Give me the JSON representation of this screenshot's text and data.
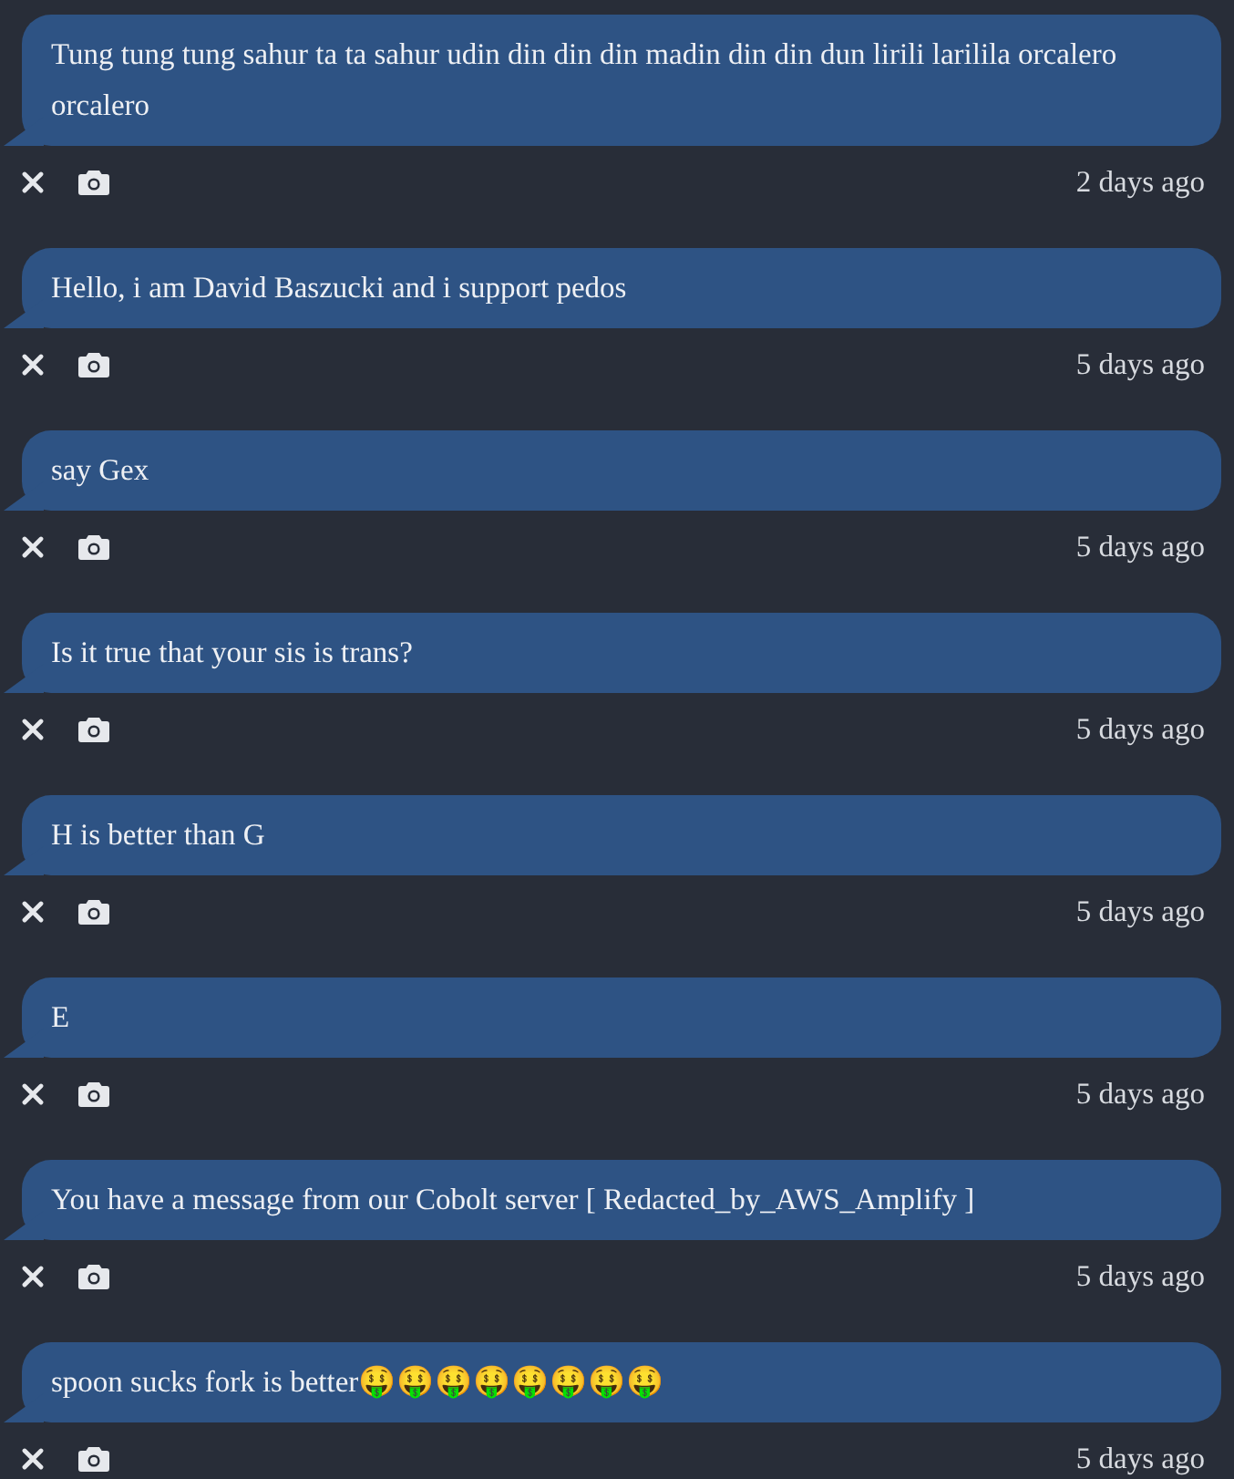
{
  "messages": [
    {
      "text": "Tung tung tung sahur ta ta sahur udin din din din madin din din dun lirili larilila orcalero orcalero",
      "time": "2 days ago"
    },
    {
      "text": "Hello, i am David Baszucki and i support pedos",
      "time": "5 days ago"
    },
    {
      "text": "say Gex",
      "time": "5 days ago"
    },
    {
      "text": "Is it true that your sis is trans?",
      "time": "5 days ago"
    },
    {
      "text": "H is better than G",
      "time": "5 days ago"
    },
    {
      "text": "E",
      "time": "5 days ago"
    },
    {
      "text": "You have a message from our Cobolt server [ Redacted_by_AWS_Amplify ]",
      "time": "5 days ago"
    },
    {
      "text": "spoon sucks fork is better🤑🤑🤑🤑🤑🤑🤑🤑",
      "time": "5 days ago"
    }
  ]
}
